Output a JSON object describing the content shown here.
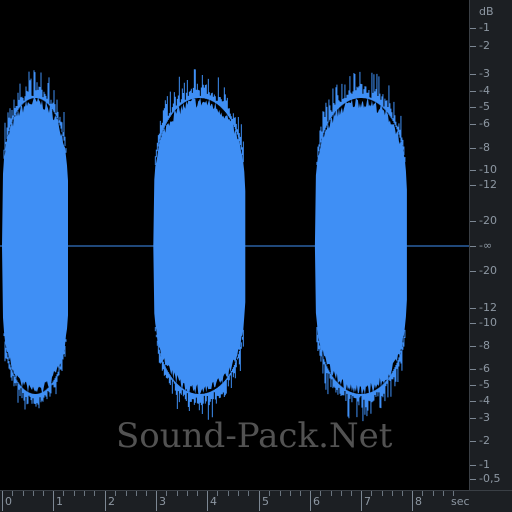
{
  "colors": {
    "waveform": "#3f8ff5",
    "background": "#000000",
    "ruler": "#1c1f23",
    "ruler_text": "#8d97a2"
  },
  "db_ruler": {
    "unit": "dB",
    "labels": [
      "-1",
      "-2",
      "-3",
      "-4",
      "-5",
      "-6",
      "-8",
      "-10",
      "-12",
      "-20",
      "-∞",
      "-20",
      "-12",
      "-10",
      "-8",
      "-6",
      "-5",
      "-4",
      "-3",
      "-2",
      "-1",
      "-0,5"
    ]
  },
  "time_ruler": {
    "unit": "sec",
    "labels": [
      "0",
      "1",
      "2",
      "3",
      "4",
      "5",
      "6",
      "7",
      "8"
    ]
  },
  "waveform": {
    "segments": [
      {
        "start_sec": 0.0,
        "end_sec": 1.3
      },
      {
        "start_sec": 2.95,
        "end_sec": 4.75
      },
      {
        "start_sec": 6.1,
        "end_sec": 7.9
      }
    ]
  },
  "watermark": {
    "text": "Sound-Pack.Net"
  }
}
